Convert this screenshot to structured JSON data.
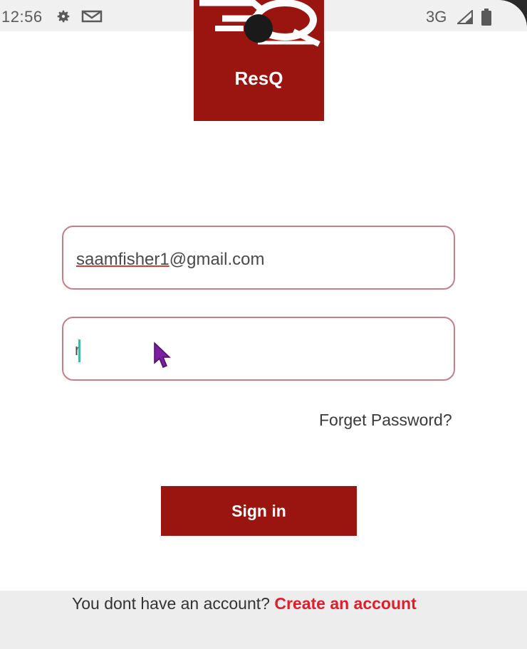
{
  "status_bar": {
    "time": "12:56",
    "network": "3G",
    "icons": [
      "gear-icon",
      "mail-icon",
      "signal-icon",
      "battery-icon"
    ]
  },
  "logo": {
    "text": "ResQ",
    "background_color": "#9b1510"
  },
  "login_form": {
    "email_user": "saamfisher1",
    "email_domain": "@gmail.com",
    "password_value": "r",
    "forgot_password": "Forget Password?",
    "sign_in_label": "Sign in"
  },
  "footer": {
    "prompt": "You dont have an account?",
    "create_account": "Create an account",
    "link_color": "#e11d2b"
  }
}
